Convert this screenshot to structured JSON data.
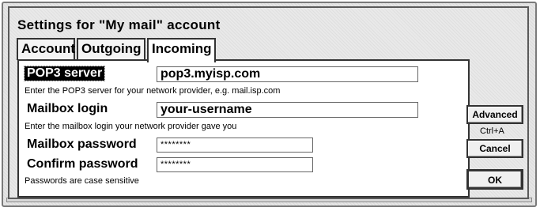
{
  "dialog": {
    "title": "Settings for \"My mail\" account"
  },
  "tabs": [
    {
      "label": "Account",
      "active": false
    },
    {
      "label": "Outgoing",
      "active": false
    },
    {
      "label": "Incoming",
      "active": true
    }
  ],
  "incoming": {
    "pop3_server": {
      "label": "POP3 server",
      "value": "pop3.myisp.com",
      "hint": "Enter the POP3 server for your network provider, e.g. mail.isp.com"
    },
    "mailbox_login": {
      "label": "Mailbox login",
      "value": "your-username",
      "hint": "Enter the mailbox login your network provider gave you"
    },
    "mailbox_password": {
      "label": "Mailbox password",
      "value": "********"
    },
    "confirm_password": {
      "label": "Confirm password",
      "value": "********"
    },
    "password_hint": "Passwords are case sensitive"
  },
  "buttons": {
    "advanced": "Advanced",
    "advanced_shortcut": "Ctrl+A",
    "cancel": "Cancel",
    "ok": "OK"
  }
}
